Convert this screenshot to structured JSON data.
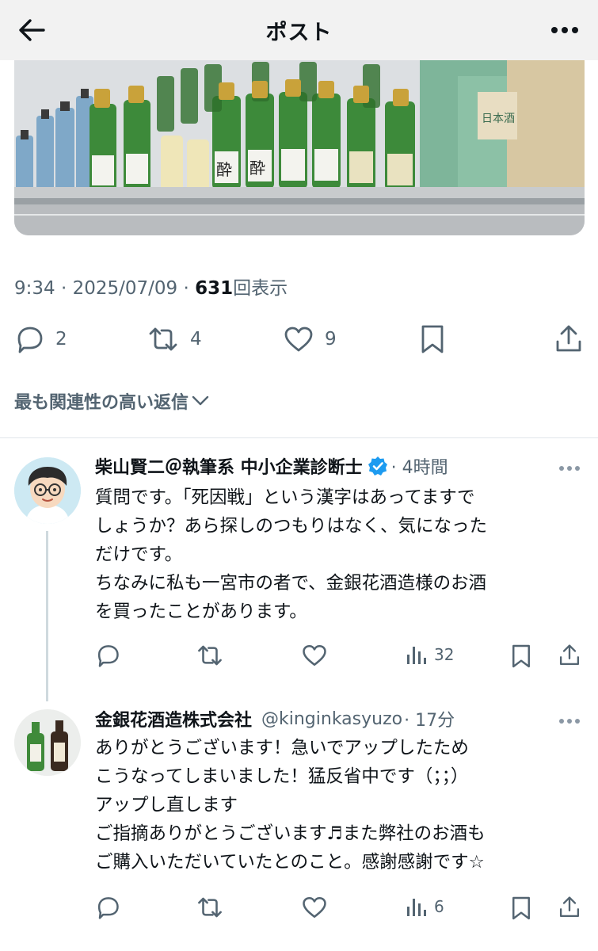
{
  "header": {
    "title": "ポスト"
  },
  "post": {
    "time": "9:34 · 2025/07/09 · ",
    "views_count": "631",
    "views_label": "回表示",
    "actions": {
      "replies": "2",
      "reposts": "4",
      "likes": "9"
    }
  },
  "replies_filter": "最も関連性の高い返信",
  "replies": [
    {
      "name": "柴山賢二＠執筆系 中小企業診断士",
      "verified": true,
      "time": "· 4時間",
      "lines": [
        "質問です。「死因戦」という漢字はあってますで",
        "しょうか？あら探しのつもりはなく、気になった",
        "だけです。",
        "ちなみに私も一宮市の者で、金銀花酒造様のお酒",
        "を買ったことがあります。"
      ],
      "views": "32"
    },
    {
      "name": "金銀花酒造株式会社",
      "handle": "@kinginkasyuzo",
      "time": "· 17分",
      "lines": [
        "ありがとうございます！急いでアップしたため",
        "こうなってしまいました！猛反省中です（；；）",
        "アップし直します",
        "ご指摘ありがとうございます♬また弊社のお酒も",
        "ご購入いただいていたとのこと。感謝感謝です☆"
      ],
      "views": "6"
    }
  ],
  "photo_labels": {
    "bottle_a": "酔",
    "bottle_b": "酔",
    "box": "日本酒"
  },
  "colors": {
    "verified": "#1d9bf0",
    "muted": "#536471",
    "text": "#0f1419"
  }
}
